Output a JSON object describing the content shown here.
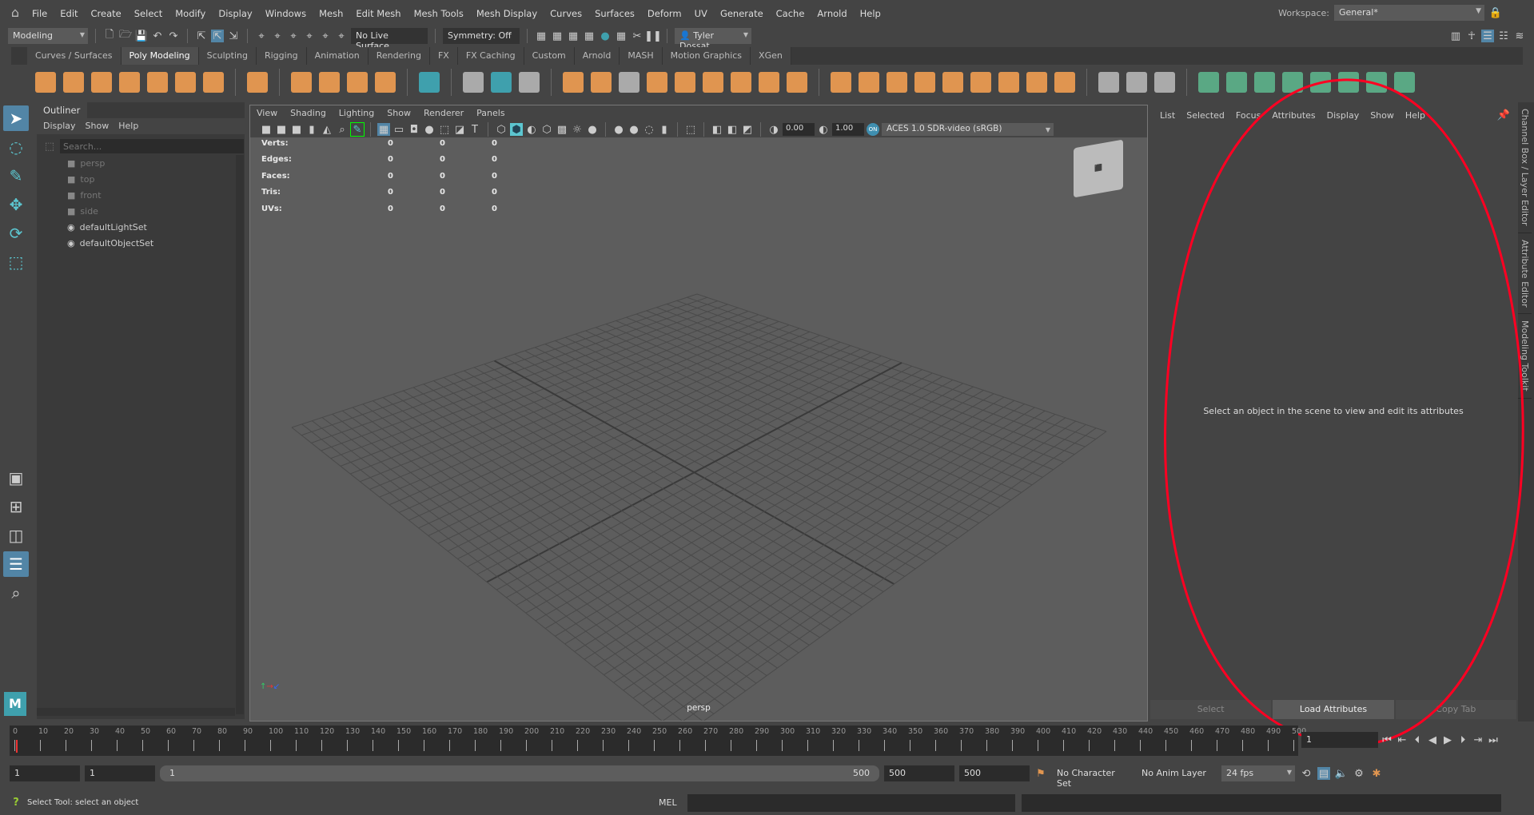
{
  "menubar": {
    "items": [
      "File",
      "Edit",
      "Create",
      "Select",
      "Modify",
      "Display",
      "Windows",
      "Mesh",
      "Edit Mesh",
      "Mesh Tools",
      "Mesh Display",
      "Curves",
      "Surfaces",
      "Deform",
      "UV",
      "Generate",
      "Cache",
      "Arnold",
      "Help"
    ],
    "workspace_label": "Workspace:",
    "workspace_value": "General*"
  },
  "toolbar": {
    "menuset": "Modeling",
    "live_surface": "No Live Surface",
    "symmetry": "Symmetry: Off",
    "user": "Tyler Dossat"
  },
  "shelf": {
    "tabs": [
      "Curves / Surfaces",
      "Poly Modeling",
      "Sculpting",
      "Rigging",
      "Animation",
      "Rendering",
      "FX",
      "FX Caching",
      "Custom",
      "Arnold",
      "MASH",
      "Motion Graphics",
      "XGen"
    ],
    "active_tab": "Poly Modeling",
    "icons": [
      [
        "sphere",
        "o"
      ],
      [
        "cube",
        "o"
      ],
      [
        "cylinder",
        "o"
      ],
      [
        "cone",
        "o"
      ],
      [
        "torus",
        "o"
      ],
      [
        "plane",
        "o"
      ],
      [
        "disc",
        "o"
      ],
      [
        "sep",
        ""
      ],
      [
        "platonic",
        "o"
      ],
      [
        "sep",
        ""
      ],
      [
        "super-shape",
        "o"
      ],
      [
        "helix",
        "o"
      ],
      [
        "text",
        "o"
      ],
      [
        "svg",
        "o"
      ],
      [
        "sep",
        ""
      ],
      [
        "uv-editor",
        "t"
      ],
      [
        "sep",
        ""
      ],
      [
        "pivot",
        "w"
      ],
      [
        "history",
        "t"
      ],
      [
        "freeze",
        "w"
      ],
      [
        "sep",
        ""
      ],
      [
        "combine",
        "o"
      ],
      [
        "separate",
        "o"
      ],
      [
        "smooth",
        "w"
      ],
      [
        "mirror",
        "o"
      ],
      [
        "extract",
        "o"
      ],
      [
        "boolean",
        "o"
      ],
      [
        "remesh",
        "o"
      ],
      [
        "retopo",
        "o"
      ],
      [
        "reduce",
        "o"
      ],
      [
        "sep",
        ""
      ],
      [
        "extrude",
        "o"
      ],
      [
        "bridge",
        "o"
      ],
      [
        "bevel",
        "o"
      ],
      [
        "append",
        "o"
      ],
      [
        "target-weld",
        "o"
      ],
      [
        "multi-cut",
        "o"
      ],
      [
        "edge-loop",
        "o"
      ],
      [
        "wedge",
        "o"
      ],
      [
        "fill-hole",
        "o"
      ],
      [
        "sep",
        ""
      ],
      [
        "quad-draw",
        "w"
      ],
      [
        "slide",
        "w"
      ],
      [
        "relax",
        "w"
      ],
      [
        "sep",
        ""
      ],
      [
        "planar-uv",
        "g"
      ],
      [
        "cylindrical-uv",
        "g"
      ],
      [
        "spherical-uv",
        "g"
      ],
      [
        "auto-uv",
        "g"
      ],
      [
        "contour-uv",
        "g"
      ],
      [
        "camera-uv",
        "g"
      ],
      [
        "unfold",
        "g"
      ],
      [
        "cut-sew",
        "g"
      ]
    ]
  },
  "outliner": {
    "tab": "Outliner",
    "menu": [
      "Display",
      "Show",
      "Help"
    ],
    "search_placeholder": "Search...",
    "items": [
      {
        "label": "persp",
        "icon": "camera-icon",
        "dim": true
      },
      {
        "label": "top",
        "icon": "camera-icon",
        "dim": true
      },
      {
        "label": "front",
        "icon": "camera-icon",
        "dim": true
      },
      {
        "label": "side",
        "icon": "camera-icon",
        "dim": true
      },
      {
        "label": "defaultLightSet",
        "icon": "set-icon",
        "dim": false
      },
      {
        "label": "defaultObjectSet",
        "icon": "set-icon",
        "dim": false
      }
    ]
  },
  "viewport": {
    "menu": [
      "View",
      "Shading",
      "Lighting",
      "Show",
      "Renderer",
      "Panels"
    ],
    "exposure": "0.00",
    "gamma": "1.00",
    "color_space": "ACES 1.0 SDR-video (sRGB)",
    "camera": "persp",
    "hud": [
      {
        "label": "Verts:",
        "values": [
          "0",
          "0",
          "0"
        ]
      },
      {
        "label": "Edges:",
        "values": [
          "0",
          "0",
          "0"
        ]
      },
      {
        "label": "Faces:",
        "values": [
          "0",
          "0",
          "0"
        ]
      },
      {
        "label": "Tris:",
        "values": [
          "0",
          "0",
          "0"
        ]
      },
      {
        "label": "UVs:",
        "values": [
          "0",
          "0",
          "0"
        ]
      }
    ]
  },
  "attribute_editor": {
    "menu": [
      "List",
      "Selected",
      "Focus",
      "Attributes",
      "Display",
      "Show",
      "Help"
    ],
    "message": "Select an object in the scene to view and edit its attributes",
    "buttons": [
      "Select",
      "Load Attributes",
      "Copy Tab"
    ]
  },
  "side_tabs": [
    "Channel Box / Layer Editor",
    "Attribute Editor",
    "Modeling Toolkit"
  ],
  "timeline": {
    "start": 0,
    "end": 500,
    "step": 10,
    "current_frame": "1"
  },
  "range": {
    "start": "1",
    "playback_start": "1",
    "slider_start": "1",
    "slider_end": "500",
    "playback_end": "500",
    "end": "500",
    "character_set": "No Character Set",
    "anim_layer": "No Anim Layer",
    "fps": "24 fps"
  },
  "command": {
    "status": "Select Tool: select an object",
    "lang": "MEL"
  },
  "annotation": {
    "color": "#ff0022"
  }
}
